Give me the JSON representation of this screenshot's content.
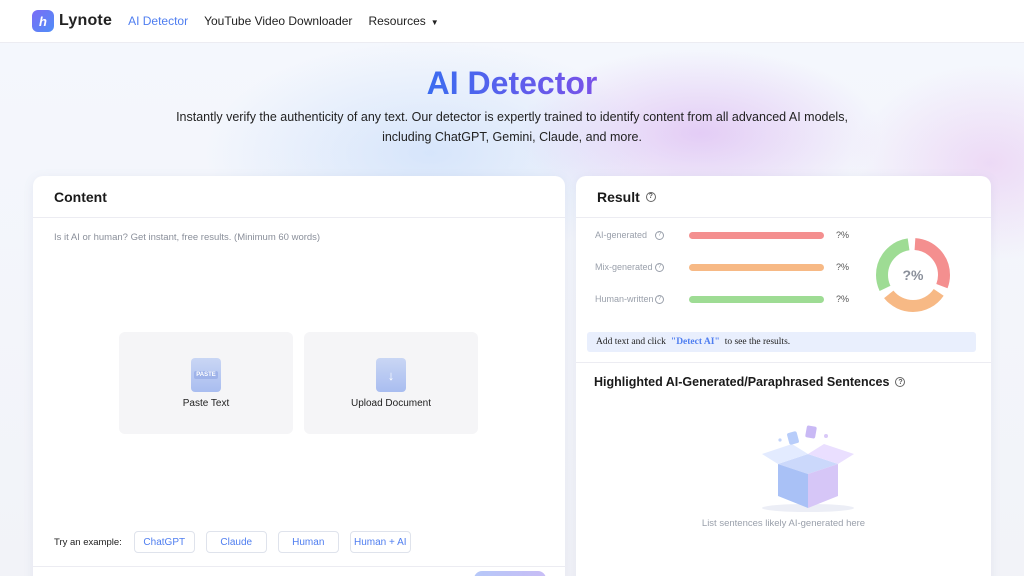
{
  "brand": {
    "name": "Lynote",
    "logo_letter": "h"
  },
  "nav": {
    "items": [
      {
        "label": "AI Detector",
        "active": true
      },
      {
        "label": "YouTube Video Downloader",
        "active": false
      },
      {
        "label": "Resources",
        "active": false
      }
    ],
    "resources_caret": "▼"
  },
  "hero": {
    "title": "AI Detector",
    "subtitle": "Instantly verify the authenticity of any text. Our detector is expertly trained to identify content from all advanced AI models, including ChatGPT, Gemini, Claude, and more."
  },
  "content_panel": {
    "title": "Content",
    "placeholder": "Is it AI or human? Get instant, free results. (Minimum 60 words)",
    "paste": {
      "label": "Paste Text",
      "icon_tag": "PASTE"
    },
    "upload": {
      "label": "Upload Document"
    },
    "examples_label": "Try an example:",
    "examples": [
      "ChatGPT",
      "Claude",
      "Human",
      "Human + AI"
    ]
  },
  "result_panel": {
    "title": "Result",
    "rows": [
      {
        "label": "AI-generated",
        "value": "?%",
        "color": "#f48f8f"
      },
      {
        "label": "Mix-generated",
        "value": "?%",
        "color": "#f7b985"
      },
      {
        "label": "Human-written",
        "value": "?%",
        "color": "#9edc94"
      }
    ],
    "donut_label": "?%",
    "hint": {
      "before": "Add text and click",
      "keyword": "\"Detect AI\"",
      "after": "to see the results."
    },
    "highlight_title": "Highlighted AI-Generated/Paraphrased Sentences",
    "empty_text": "List sentences likely AI-generated here"
  },
  "colors": {
    "accent": "#4f7ef0",
    "ai": "#f48f8f",
    "mix": "#f7b985",
    "human": "#9edc94"
  }
}
